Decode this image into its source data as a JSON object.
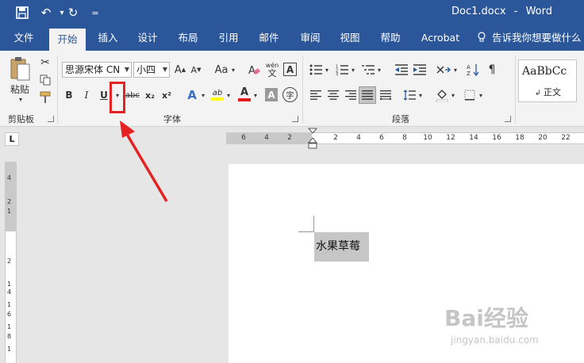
{
  "window": {
    "doc_name": "Doc1.docx",
    "separator": "-",
    "app_name": "Word"
  },
  "tabs": [
    {
      "label": "文件"
    },
    {
      "label": "开始"
    },
    {
      "label": "插入"
    },
    {
      "label": "设计"
    },
    {
      "label": "布局"
    },
    {
      "label": "引用"
    },
    {
      "label": "邮件"
    },
    {
      "label": "审阅"
    },
    {
      "label": "视图"
    },
    {
      "label": "帮助"
    },
    {
      "label": "Acrobat"
    },
    {
      "label": "告诉我你想要做什么"
    }
  ],
  "clipboard": {
    "paste_label": "粘贴",
    "group_label": "剪贴板"
  },
  "font": {
    "font_name": "思源宋体 CN",
    "font_size": "小四",
    "grow_label": "A",
    "shrink_label": "A",
    "case_label": "Aa",
    "phonetic_top": "wén",
    "phonetic_bottom": "文",
    "border_char": "A",
    "bold": "B",
    "italic": "I",
    "underline": "U",
    "strike": "abc",
    "subscript": "x₂",
    "superscript": "x²",
    "effects": "A",
    "highlight": "ab",
    "color": "A",
    "shading": "A",
    "enclose": "字",
    "group_label": "字体"
  },
  "paragraph": {
    "group_label": "段落"
  },
  "styles": {
    "preview": "AaBbCc",
    "normal_label": "正文"
  },
  "ruler": {
    "h_ticks": [
      "6",
      "4",
      "2",
      "2",
      "4",
      "6",
      "8",
      "10",
      "12",
      "14",
      "16",
      "18",
      "20",
      "22"
    ],
    "v_ticks": [
      "4",
      "2",
      "1",
      "2",
      "1",
      "4",
      "1",
      "6",
      "1",
      "8",
      "1"
    ],
    "corner": "L"
  },
  "document": {
    "text": "水果草莓"
  },
  "watermark": {
    "text": "Bai经验",
    "url": "jingyan.baidu.com"
  }
}
